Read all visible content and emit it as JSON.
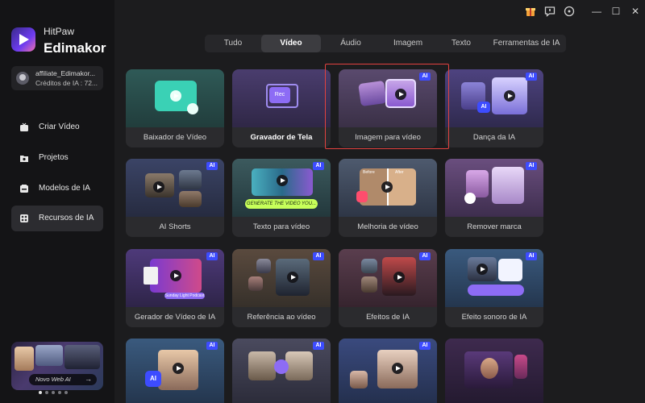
{
  "app": {
    "brand_line1": "HitPaw",
    "brand_line2": "Edimakor"
  },
  "account": {
    "name": "affiliate_Edimakor...",
    "credits": "Créditos de IA : 72..."
  },
  "sidebar": {
    "items": [
      {
        "label": "Criar Vídeo",
        "icon": "video-create-icon"
      },
      {
        "label": "Projetos",
        "icon": "folder-star-icon"
      },
      {
        "label": "Modelos de IA",
        "icon": "ai-models-icon"
      },
      {
        "label": "Recursos de IA",
        "icon": "ai-resources-icon",
        "active": true
      }
    ],
    "promo": {
      "text": "Novo Web AI",
      "arrow": "→",
      "slides": 5,
      "current": 1
    }
  },
  "titlebar": {
    "icons": [
      "gift-icon",
      "feedback-icon",
      "settings-icon",
      "minimize-icon",
      "maximize-icon",
      "close-icon"
    ],
    "minimize": "—",
    "maximize": "☐",
    "close": "✕"
  },
  "tabs": [
    {
      "label": "Tudo"
    },
    {
      "label": "Vídeo",
      "active": true
    },
    {
      "label": "Áudio"
    },
    {
      "label": "Imagem"
    },
    {
      "label": "Texto"
    },
    {
      "label": "Ferramentas de IA"
    }
  ],
  "badge_text": "AI",
  "cards": [
    {
      "label": "Baixador de Vídeo",
      "ai": false
    },
    {
      "label": "Gravador de Tela",
      "ai": false,
      "bold": true
    },
    {
      "label": "Imagem para vídeo",
      "ai": true,
      "selected": true
    },
    {
      "label": "Dança da IA",
      "ai": true
    },
    {
      "label": "AI Shorts",
      "ai": true
    },
    {
      "label": "Texto para vídeo",
      "ai": true
    },
    {
      "label": "Melhoria de vídeo",
      "ai": false
    },
    {
      "label": "Remover marca",
      "ai": true
    },
    {
      "label": "Gerador de Vídeo de IA",
      "ai": true
    },
    {
      "label": "Referência ao vídeo",
      "ai": true
    },
    {
      "label": "Efeitos de IA",
      "ai": true
    },
    {
      "label": "Efeito sonoro de IA",
      "ai": true
    },
    {
      "label": "",
      "ai": true
    },
    {
      "label": "",
      "ai": true
    },
    {
      "label": "",
      "ai": true
    },
    {
      "label": "",
      "ai": false
    }
  ],
  "thumb_text": {
    "rec": "Rec",
    "generate": "GENERATE THE VIDEO YOU...",
    "before": "Before",
    "after": "After",
    "sunday": "Sunday Light Podcast",
    "ai": "AI"
  },
  "colors": {
    "accent": "#3d4cff",
    "selected_outline": "#e2423f",
    "background": "#1c1c1e",
    "sidebar": "#141416"
  }
}
